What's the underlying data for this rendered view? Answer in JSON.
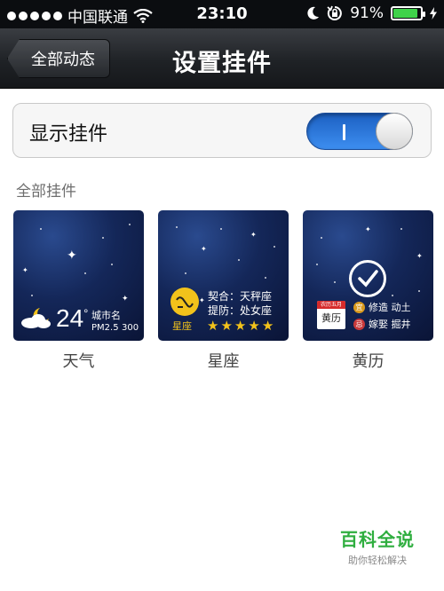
{
  "status_bar": {
    "carrier": "中国联通",
    "time": "23:10",
    "battery_percent": "91%",
    "battery_level": 0.91
  },
  "nav": {
    "back_label": "全部动态",
    "title": "设置挂件"
  },
  "settings": {
    "show_widget_label": "显示挂件",
    "show_widget_on": true
  },
  "section": {
    "title": "全部挂件"
  },
  "widgets": [
    {
      "label": "天气",
      "temperature": "24",
      "degree": "°",
      "city": "城市名",
      "pm_label": "PM2.5",
      "pm_value": "300"
    },
    {
      "label": "星座",
      "zodiac_name": "星座",
      "match": "契合：天秤座",
      "avoid": "提防：处女座",
      "rating": 5
    },
    {
      "label": "黄历",
      "calendar_header": "农历五月",
      "calendar_body": "黄历",
      "yi_badge": "宜",
      "ji_badge": "忌",
      "yi_text": "修造  动土",
      "ji_text": "嫁娶  掘井"
    }
  ],
  "watermark": {
    "title": "百科全说",
    "subtitle": "助你轻松解决"
  },
  "colors": {
    "switch_on": "#3d8ef0",
    "watermark_green": "#2fae3f",
    "zodiac_yellow": "#f2c21b"
  }
}
